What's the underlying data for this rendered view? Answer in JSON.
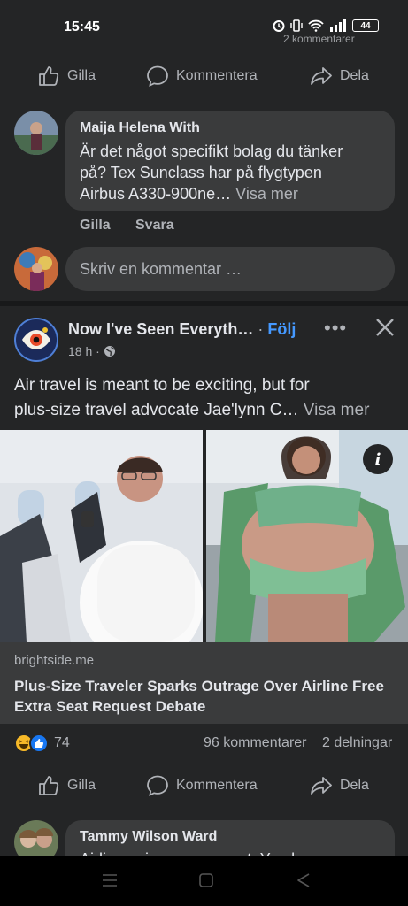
{
  "status_bar": {
    "time": "15:45",
    "battery": "44",
    "clipped_text": "2 kommentarer"
  },
  "top_actions": {
    "like": "Gilla",
    "comment": "Kommentera",
    "share": "Dela"
  },
  "comment": {
    "author": "Maija Helena With",
    "text_line1": "Är det något specifikt bolag du tänker",
    "text_line2": "på? Tex Sunclass har på flygtypen",
    "text_line3": "Airbus A330-900ne…",
    "see_more": "Visa mer",
    "like": "Gilla",
    "reply": "Svara"
  },
  "composer": {
    "placeholder": "Skriv en kommentar …"
  },
  "post": {
    "page_name": "Now I've Seen Everyth…",
    "separator": "·",
    "follow": "Följ",
    "time": "18 h ·",
    "text_line1": "Air travel is meant to be exciting, but for",
    "text_line2": "plus-size travel advocate Jae'lynn C…",
    "see_more": "Visa mer",
    "info_badge": "i",
    "link": {
      "domain": "brightside.me",
      "title": "Plus-Size Traveler Sparks Outrage Over Airline Free Extra Seat Request Debate"
    },
    "reactions_count": "74",
    "comments_count": "96 kommentarer",
    "shares_count": "2 delningar"
  },
  "bottom_actions": {
    "like": "Gilla",
    "comment": "Kommentera",
    "share": "Dela"
  },
  "next_comment": {
    "author": "Tammy Wilson Ward",
    "text_partial": "Airlines gives you a seat. You know"
  },
  "colors": {
    "background": "#242526",
    "bubble": "#3a3b3c",
    "link_blue": "#4599ff",
    "muted": "#b0b3b8"
  }
}
